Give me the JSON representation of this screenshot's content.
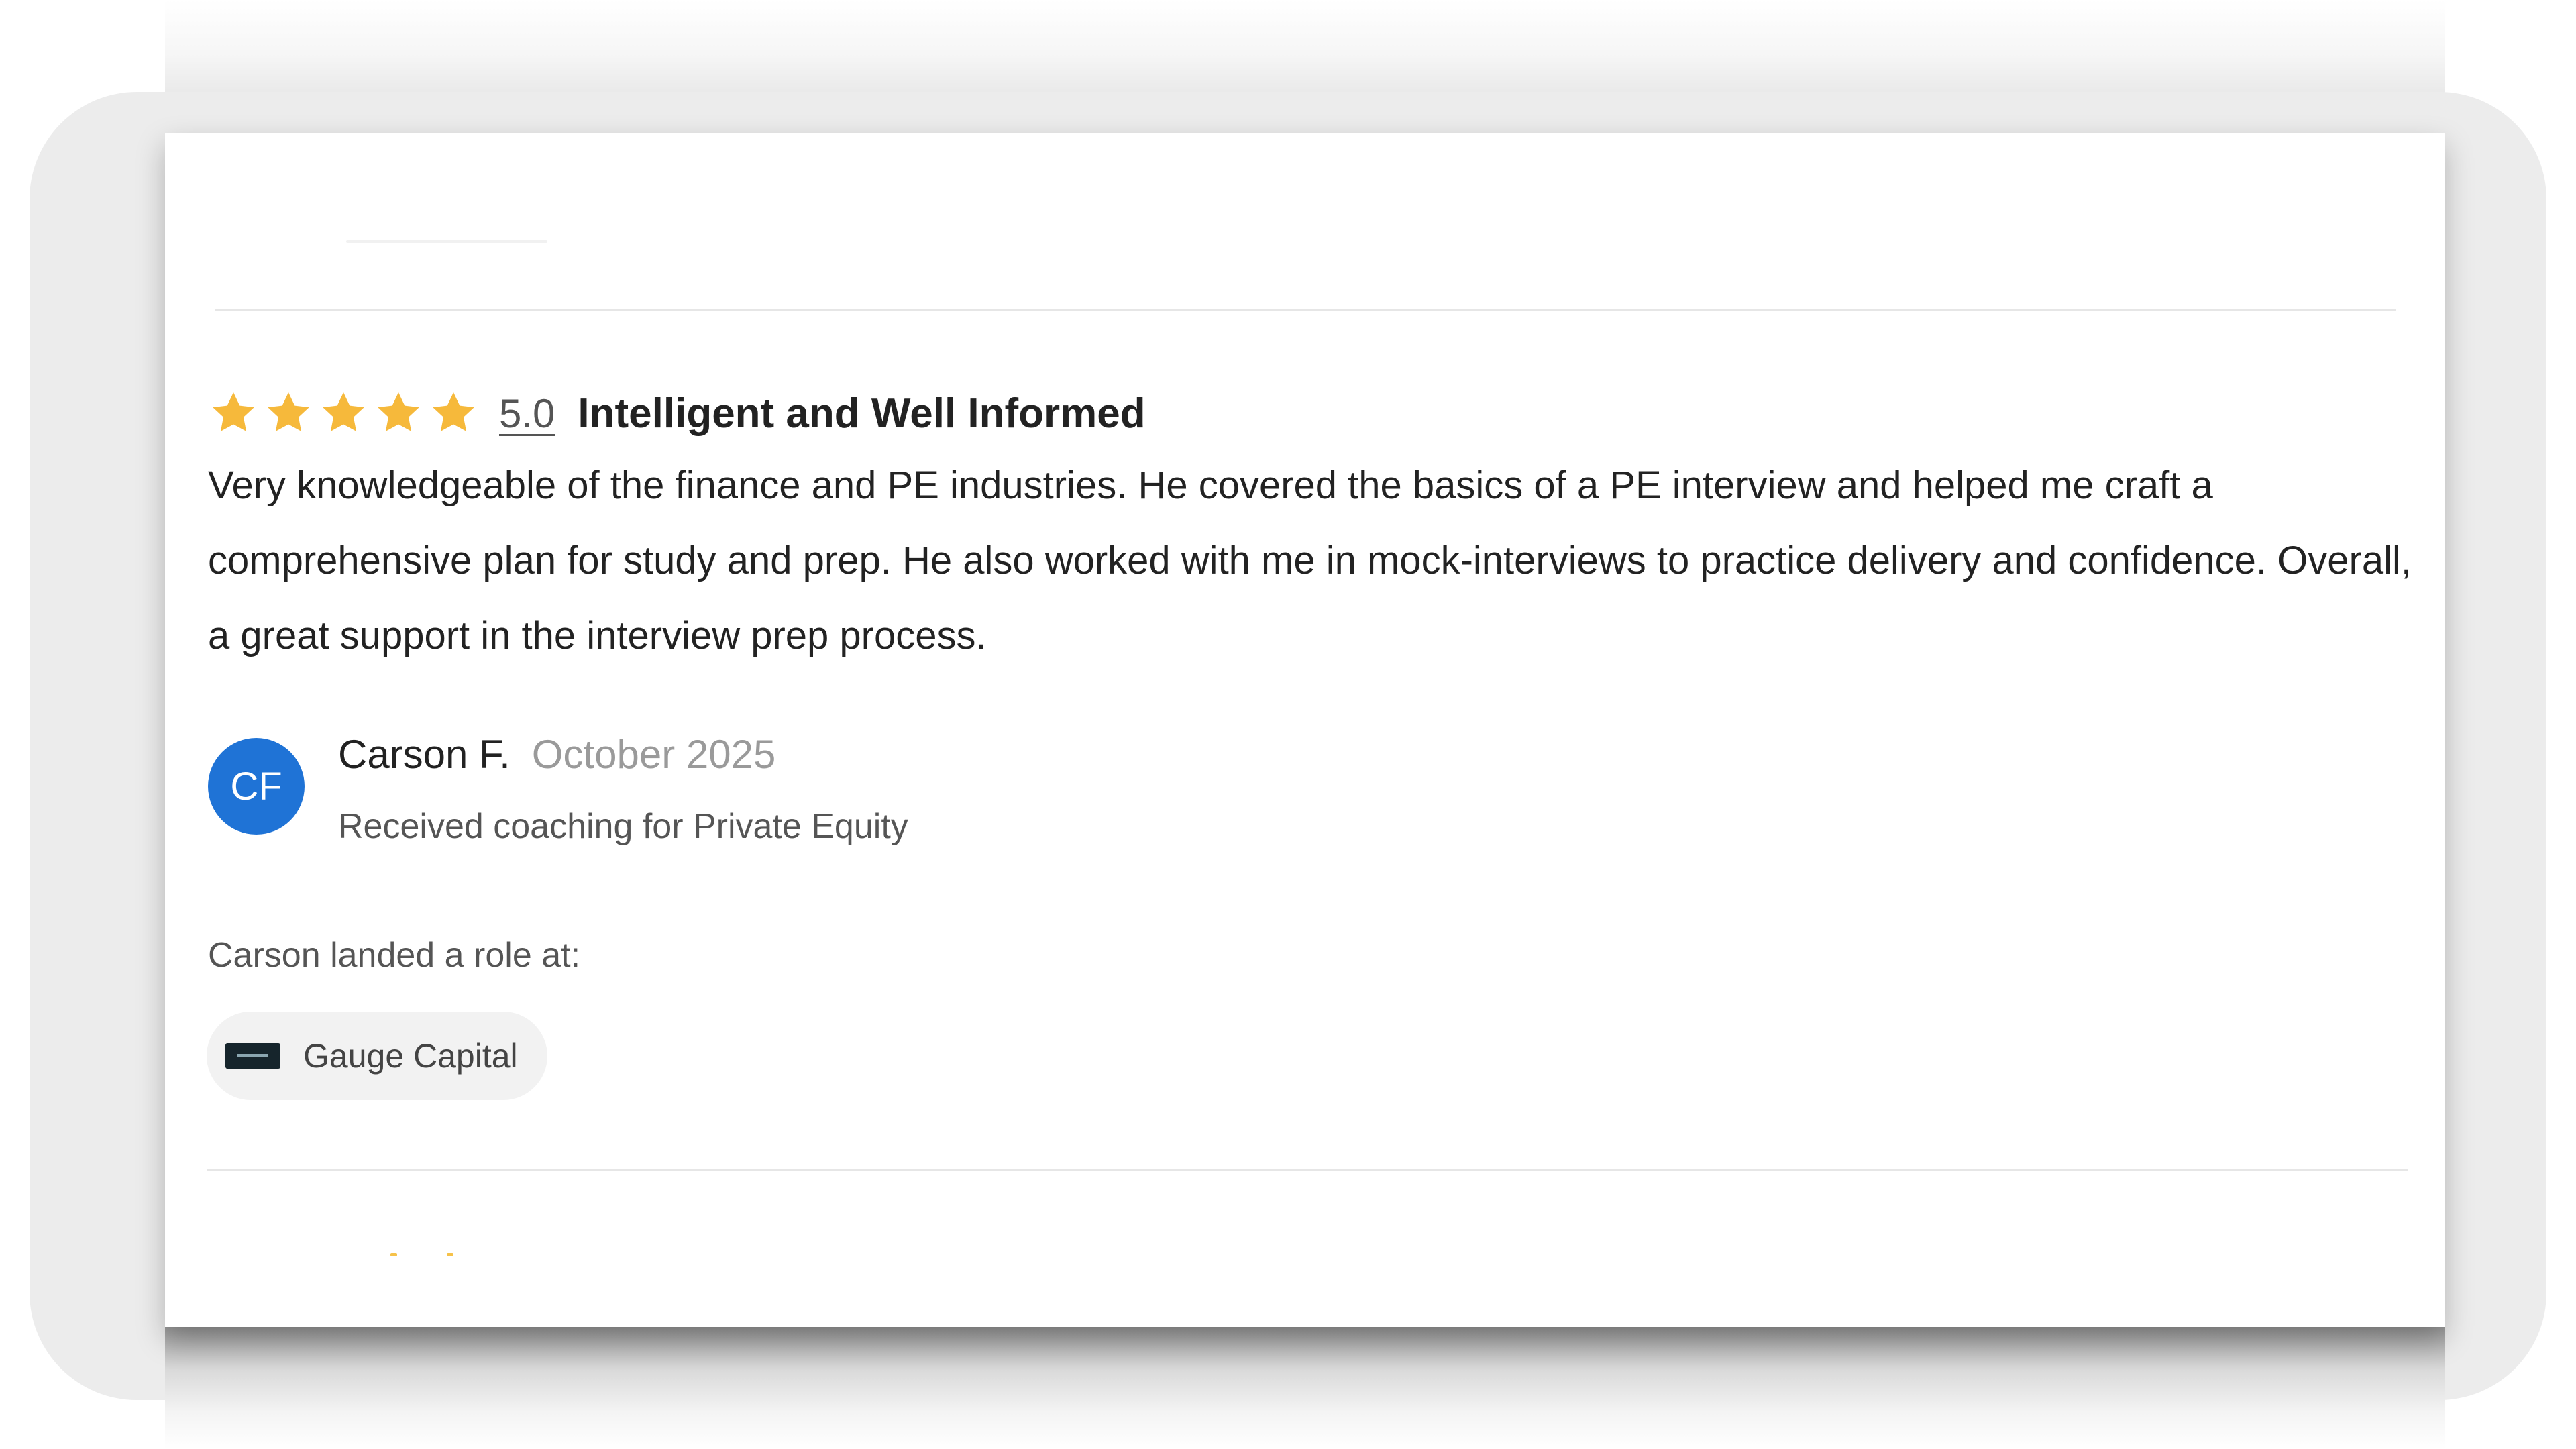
{
  "review": {
    "rating_value": "5.0",
    "stars": 5,
    "star_color": "#F6B93B",
    "title": "Intelligent and Well Informed",
    "body": "Very knowledgeable of the finance and PE industries. He covered the basics of a PE interview and helped me craft a comprehensive plan for study and prep. He also worked with me in mock-interviews to practice delivery and confidence. Overall, a great support in the interview prep process."
  },
  "author": {
    "initials": "CF",
    "avatar_color": "#1F73D6",
    "name": "Carson F.",
    "date": "October 2025",
    "coaching": "Received coaching for Private Equity"
  },
  "outcome": {
    "label": "Carson landed a role at:",
    "company": "Gauge Capital"
  }
}
